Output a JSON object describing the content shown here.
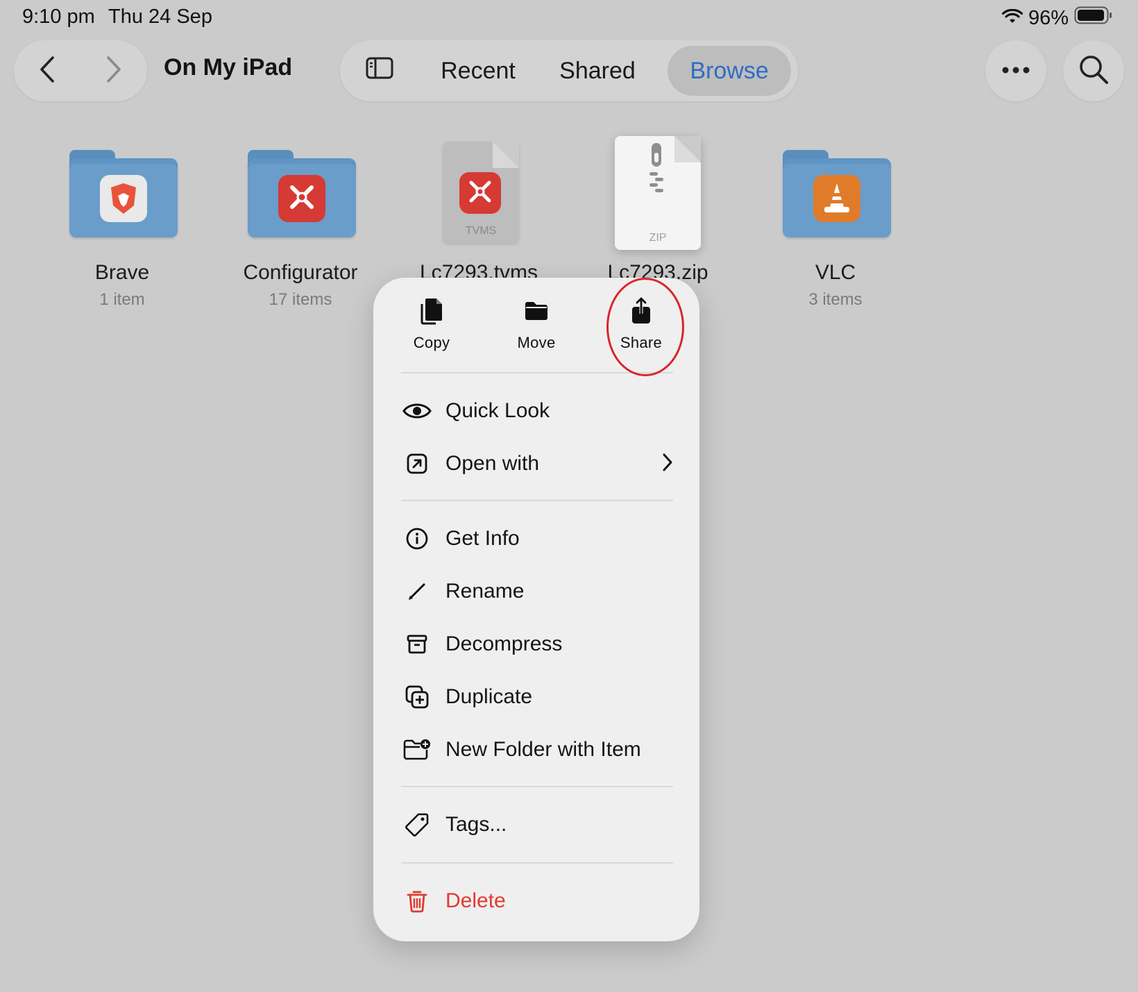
{
  "status_bar": {
    "time": "9:10 pm",
    "date": "Thu 24 Sep",
    "battery": "96%"
  },
  "header": {
    "title": "On My iPad",
    "tabs": [
      {
        "label": "Recent",
        "active": false
      },
      {
        "label": "Shared",
        "active": false
      },
      {
        "label": "Browse",
        "active": true
      }
    ],
    "icons": [
      "back-icon",
      "forward-icon",
      "sidebar-icon",
      "more-icon",
      "search-icon"
    ]
  },
  "files": [
    {
      "name": "Brave",
      "sub": "1 item",
      "kind": "folder",
      "badge": "brave-icon"
    },
    {
      "name": "Configurator",
      "sub": "17 items",
      "kind": "folder",
      "badge": "redarc-icon"
    },
    {
      "name": "Lc7293.tvms",
      "sub": "",
      "kind": "document",
      "doc_label": "TVMS",
      "badge": "redarc-icon"
    },
    {
      "name": "Lc7293.zip",
      "sub": "",
      "kind": "zip",
      "doc_label": "ZIP"
    },
    {
      "name": "VLC",
      "sub": "3 items",
      "kind": "folder",
      "badge": "vlc-icon"
    }
  ],
  "context_menu": {
    "actions": [
      {
        "label": "Copy",
        "icon": "copy-icon"
      },
      {
        "label": "Move",
        "icon": "folder-icon"
      },
      {
        "label": "Share",
        "icon": "share-icon"
      }
    ],
    "items": [
      {
        "label": "Quick Look",
        "icon": "eye-icon"
      },
      {
        "label": "Open with",
        "icon": "open-with-icon",
        "submenu": true
      },
      {
        "label": "Get Info",
        "icon": "info-icon"
      },
      {
        "label": "Rename",
        "icon": "pencil-icon"
      },
      {
        "label": "Decompress",
        "icon": "archive-icon"
      },
      {
        "label": "Duplicate",
        "icon": "duplicate-icon"
      },
      {
        "label": "New Folder with Item",
        "icon": "new-folder-icon"
      },
      {
        "label": "Tags...",
        "icon": "tag-icon"
      },
      {
        "label": "Delete",
        "icon": "trash-icon",
        "destructive": true
      }
    ]
  },
  "colors": {
    "accent": "#2f6cc4",
    "destructive": "#e03a32",
    "annotation": "#d9262a",
    "folder": "#6a9dca"
  }
}
